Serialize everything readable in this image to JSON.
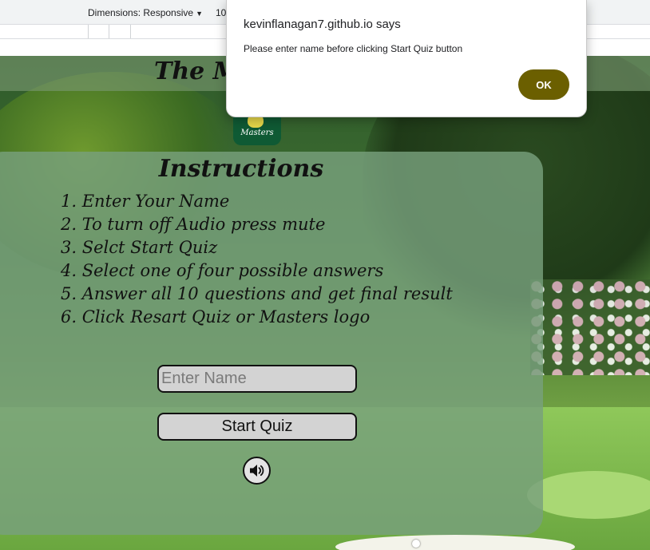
{
  "devtools": {
    "dimensions_label": "Dimensions: Responsive",
    "caret": "▼",
    "width_value": "10"
  },
  "page": {
    "title": "The Masters Quiz",
    "logo_text": "Masters",
    "instructions": {
      "title": "Instructions",
      "steps": [
        "1. Enter Your Name",
        "2. To turn off Audio press mute",
        "3. Selct Start Quiz",
        "4. Select one of four possible answers",
        "5. Answer all 10 questions and get final result",
        "6. Click Resart Quiz or Masters logo"
      ]
    },
    "name_input": {
      "placeholder": "Enter Name",
      "value": ""
    },
    "start_button_label": "Start Quiz",
    "audio_icon": "speaker-volume-icon"
  },
  "alert": {
    "title": "kevinflanagan7.github.io says",
    "message": "Please enter name before clicking Start Quiz button",
    "ok_label": "OK"
  },
  "colors": {
    "ok_button": "#6b5f00",
    "logo_green": "#0f5a34",
    "card_overlay": "#78a07d"
  }
}
